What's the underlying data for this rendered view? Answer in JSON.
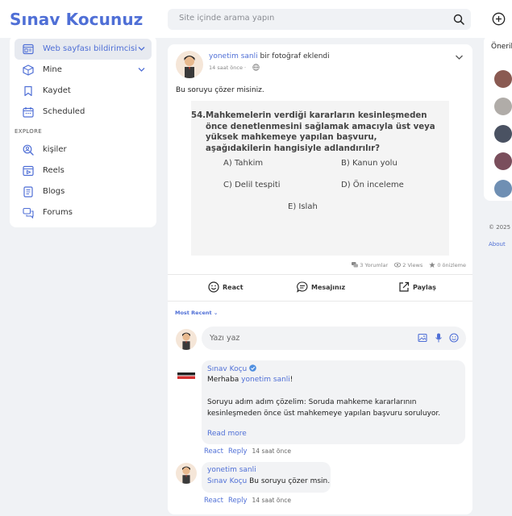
{
  "header": {
    "logo": "Sınav Kocunuz",
    "search_placeholder": "Site içinde arama yapın"
  },
  "sidebar": {
    "items": [
      {
        "label": "Web sayfası bildirimcisi",
        "icon": "browser-icon",
        "active": true,
        "expandable": true
      },
      {
        "label": "Mine",
        "icon": "dice-icon",
        "active": false,
        "expandable": true
      },
      {
        "label": "Kaydet",
        "icon": "bookmark-icon",
        "active": false
      },
      {
        "label": "Scheduled",
        "icon": "calendar-icon",
        "active": false
      }
    ],
    "explore_heading": "EXPLORE",
    "explore_items": [
      {
        "label": "kişiler",
        "icon": "people-search-icon"
      },
      {
        "label": "Reels",
        "icon": "video-icon"
      },
      {
        "label": "Blogs",
        "icon": "document-icon"
      },
      {
        "label": "Forums",
        "icon": "chat-bubbles-icon"
      }
    ]
  },
  "right_panel": {
    "title": "Öneril",
    "copyright": "© 2025 S",
    "about": "About"
  },
  "post": {
    "author": "yonetim sanli",
    "action": " bir fotoğraf eklendi",
    "time": "14 saat önce ·",
    "text": "Bu soruyu çözer misiniz.",
    "question": {
      "number": "54.",
      "text": "Mahkemelerin verdiği kararların kesinleşmeden önce denetlenmesini sağlamak amacıyla üst veya yüksek mahkemeye yapılan başvuru, aşağıdakilerin hangisiyle adlandırılır?",
      "options": {
        "a": "A) Tahkim",
        "b": "B) Kanun yolu",
        "c": "C) Delil tespiti",
        "d": "D) Ön inceleme",
        "e": "E) Islah"
      }
    },
    "stats": {
      "comments": "3 Yorumlar",
      "views": "2 Views",
      "reviews": "0 önizleme"
    },
    "actions": {
      "react": "React",
      "message": "Mesajınız",
      "share": "Paylaş"
    },
    "sort_label": "Most Recent ⌄"
  },
  "composer": {
    "placeholder": "Yazı yaz"
  },
  "comments": [
    {
      "author": "Sınav Koçu",
      "verified": true,
      "greeting_prefix": "Merhaba ",
      "mention": "yonetim sanli",
      "greeting_suffix": "!",
      "body_line1": "Soruyu adım adım çözelim: Soruda mahkeme kararlarının",
      "body_line2": "kesinleşmeden önce üst mahkemeye yapılan başvuru soruluyor.",
      "read_more": "Read more",
      "react": "React",
      "reply": "Reply",
      "time": "14 saat önce"
    },
    {
      "author": "yonetim sanli",
      "mention": "Sınav Koçu",
      "text": " Bu soruyu çözer msin.",
      "react": "React",
      "reply": "Reply",
      "time": "14 saat önce"
    }
  ],
  "colors": {
    "accent": "#4f6fd6",
    "background": "#f0f2f5",
    "card": "#ffffff"
  }
}
